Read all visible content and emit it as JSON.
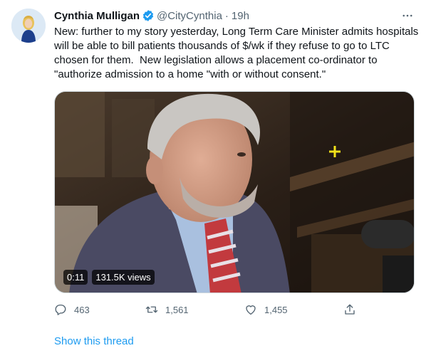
{
  "tweet": {
    "author_name": "Cynthia Mulligan",
    "handle": "@CityCynthia",
    "separator": "·",
    "time": "19h",
    "text": "New: further to my story yesterday, Long Term Care Minister admits hospitals will be able to bill patients thousands of $/wk if they refuse to go to LTC chosen for them.  New legislation allows a placement co-ordinator to \"authorize admission to a home \"with or without consent.\"",
    "verified_icon": "verified-badge-icon",
    "more_icon": "more-options-icon"
  },
  "video": {
    "duration": "0:11",
    "views": "131.5K views"
  },
  "actions": {
    "replies": "463",
    "retweets": "1,561",
    "likes": "1,455",
    "reply_icon": "reply-icon",
    "retweet_icon": "retweet-icon",
    "like_icon": "heart-icon",
    "share_icon": "share-icon"
  },
  "thread_link": "Show this thread",
  "colors": {
    "accent": "#1d9bf0",
    "text_primary": "#0f1419",
    "text_secondary": "#536471"
  }
}
